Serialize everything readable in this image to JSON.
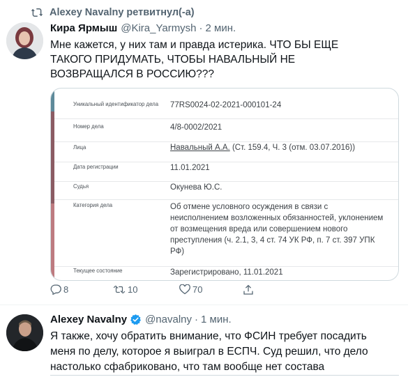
{
  "retweet": {
    "text": "Alexey Navalny ретвитнул(-а)"
  },
  "tweet1": {
    "author": "Кира Ярмыш",
    "handle": "@Kira_Yarmysh",
    "time": "2 мин.",
    "text": "Мне кажется, у них там и правда истерика. ЧТО БЫ ЕЩЕ ТАКОГО ПРИДУМАТЬ, ЧТОБЫ НАВАЛЬНЫЙ НЕ ВОЗВРАЩАЛСЯ В РОССИЮ???",
    "case": {
      "rows": [
        {
          "key": "Уникальный идентификатор дела",
          "value": "77RS0024-02-2021-000101-24"
        },
        {
          "key": "Номер дела",
          "value": "4/8-0002/2021"
        },
        {
          "key": "Лица",
          "value_link": "Навальный А.А.",
          "value": " (Ст. 159.4, Ч. 3 (отм. 03.07.2016))"
        },
        {
          "key": "Дата регистрации",
          "value": "11.01.2021"
        },
        {
          "key": "Судья",
          "value": "Окунева Ю.С."
        },
        {
          "key": "Категория дела",
          "value": "Об отмене условного осуждения в связи с неисполнением возложенных обязанностей, уклонением от возмещения вреда или совершением нового преступления (ч. 2.1, 3, 4 ст. 74 УК РФ, п. 7 ст. 397 УПК РФ)"
        },
        {
          "key": "Текущее состояние",
          "value": "Зарегистрировано, 11.01.2021"
        }
      ]
    },
    "replies": "8",
    "retweets": "10",
    "likes": "70"
  },
  "tweet2": {
    "author": "Alexey Navalny",
    "handle": "@navalny",
    "time": "1 мин.",
    "text": "Я также, хочу обратить внимание, что ФСИН требует посадить меня по делу, которое я выиграл в ЕСПЧ. Суд решил, что дело настолько сфабриковано, что там вообще нет состава преступления."
  },
  "colors": {
    "text": "#0f1419",
    "secondary": "#536471",
    "verified": "#1d9bf0",
    "border": "#cfd9de"
  },
  "icons": [
    "retweet-icon",
    "reply-icon",
    "retweet-icon",
    "like-icon",
    "share-icon",
    "verified-badge-icon"
  ]
}
